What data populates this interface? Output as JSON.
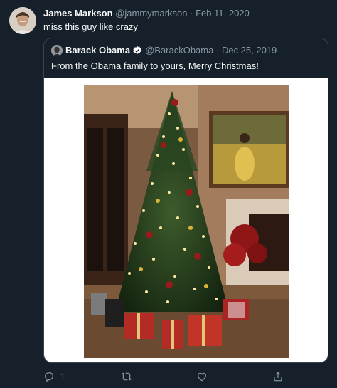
{
  "tweet": {
    "author_name": "James Markson",
    "handle": "@jammymarkson",
    "separator": "·",
    "date": "Feb 11, 2020",
    "text": "miss this guy like crazy"
  },
  "quoted_tweet": {
    "author_name": "Barack Obama",
    "handle": "@BarackObama",
    "separator": "·",
    "date": "Dec 25, 2019",
    "text": "From the Obama family to yours, Merry Christmas!",
    "verified": true,
    "image_subject": "christmas-tree-photo"
  },
  "actions": {
    "reply_count": "1",
    "icons": [
      "reply-icon",
      "retweet-icon",
      "like-icon",
      "share-icon"
    ]
  },
  "colors": {
    "background": "#15202b",
    "text": "#f7f9f9",
    "muted": "#8b98a5",
    "border": "#38444d",
    "verified_badge": "#ffffff"
  }
}
